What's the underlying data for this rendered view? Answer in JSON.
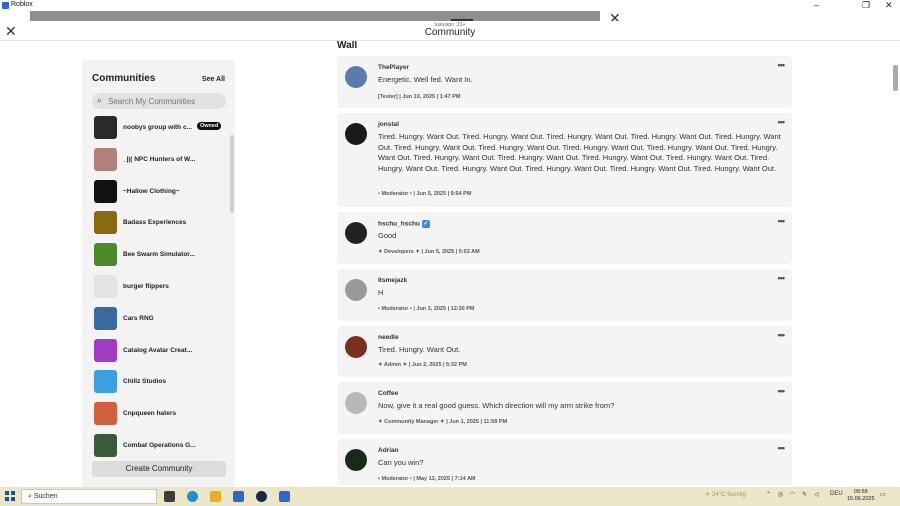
{
  "window": {
    "app_title": "Roblox"
  },
  "header": {
    "subtitle": "ʇuǝɯǝpıɹ ;13+",
    "title": "Community"
  },
  "sidebar": {
    "heading": "Communities",
    "see_all": "See All",
    "search_placeholder": "Search My Communities",
    "items": [
      {
        "name": "noobys group with c...",
        "badge": "Owned",
        "color": "#2a2a2a"
      },
      {
        "name": "_||( NPC Hunters of W...",
        "badge": "",
        "color": "#b0807a"
      },
      {
        "name": "~Hallow Clothing~",
        "badge": "",
        "color": "#111111"
      },
      {
        "name": "Badass Experiences",
        "badge": "",
        "color": "#8a6a10"
      },
      {
        "name": "Bee Swarm Simulator...",
        "badge": "",
        "color": "#4a8a2a"
      },
      {
        "name": "burger flippers",
        "badge": "",
        "color": "#e4e4e4"
      },
      {
        "name": "Cars RNG",
        "badge": "",
        "color": "#3a6aa0"
      },
      {
        "name": "Catalog Avatar Creat...",
        "badge": "",
        "color": "#a03cc0"
      },
      {
        "name": "Chillz Studios",
        "badge": "",
        "color": "#3aa0e0"
      },
      {
        "name": "Cnpqueen haters",
        "badge": "",
        "color": "#d06040"
      },
      {
        "name": "Combat Operations G...",
        "badge": "",
        "color": "#3a5a3a"
      }
    ],
    "create_button": "Create Community"
  },
  "wall": {
    "title": "Wall",
    "posts": [
      {
        "author": "ThePlayer",
        "verified": false,
        "body": "Energetic. Well fed. Want In.",
        "meta": "[Tester] | Jun 10, 2025 | 1:47 PM",
        "avatar_color": "#5a7ab0"
      },
      {
        "author": "jonstal",
        "verified": false,
        "body": "Tired. Hungry. Want Out. Tired. Hungry. Want Out. Tired. Hungry. Want Out. Tired. Hungry. Want Out. Tired. Hungry. Want Out. Tired. Hungry. Want Out. Tired. Hungry. Want Out. Tired. Hungry. Want Out. Tired. Hungry. Want Out. Tired. Hungry. Want Out. Tired. Hungry. Want Out. Tired. Hungry. Want Out. Tired. Hungry. Want Out. Tired. Hungry. Want Out. Tired. Hungry. Want Out. Tired. Hungry. Want Out. Tired. Hungry. Want Out. Tired. Hungry. Want Out. Tired. Hungry. Want Out.",
        "meta": "• Moderator • | Jun 5, 2025 | 9:54 PM",
        "avatar_color": "#1a1a1a"
      },
      {
        "author": "hschu_hschu",
        "verified": true,
        "body": "Good",
        "meta": "✦ Developers ✦ | Jun 5, 2025 | 5:03 AM",
        "avatar_color": "#222222"
      },
      {
        "author": "Itsmejazk",
        "verified": false,
        "body": "H",
        "meta": "• Moderator • | Jun 3, 2025 | 12:30 PM",
        "avatar_color": "#9a9a9a"
      },
      {
        "author": "needle",
        "verified": false,
        "body": "Tired. Hungry. Want Out.",
        "meta": "✦ Admin ✦ | Jun 2, 2025 | 5:32 PM",
        "avatar_color": "#7a3020"
      },
      {
        "author": "Coffee",
        "verified": false,
        "body": "Now, give it a real good guess. Which direction will my arm strike from?",
        "meta": "✦ Community Manager ✦ | Jun 1, 2025 | 11:58 PM",
        "avatar_color": "#b8b8b8"
      },
      {
        "author": "Adrian",
        "verified": false,
        "body": "Can you win?",
        "meta": "• Moderator • | May 13, 2025 | 7:14 AM",
        "avatar_color": "#1a2a1a"
      }
    ]
  },
  "taskbar": {
    "search_label": "Suchen",
    "weather": "24°C Sonnig",
    "language": "DEU",
    "time": "09:58",
    "date": "15.06.2025"
  }
}
